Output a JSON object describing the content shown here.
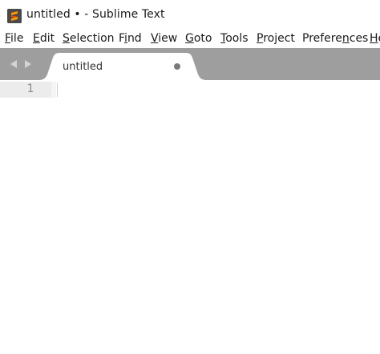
{
  "window": {
    "title": "untitled • - Sublime Text",
    "app_icon": "sublime-text-logo-icon"
  },
  "menu": {
    "items": [
      {
        "label": "File",
        "mnemonic": "F"
      },
      {
        "label": "Edit",
        "mnemonic": "E"
      },
      {
        "label": "Selection",
        "mnemonic": "S"
      },
      {
        "label": "Find",
        "mnemonic": "i"
      },
      {
        "label": "View",
        "mnemonic": "V"
      },
      {
        "label": "Goto",
        "mnemonic": "G"
      },
      {
        "label": "Tools",
        "mnemonic": "T"
      },
      {
        "label": "Project",
        "mnemonic": "P"
      },
      {
        "label": "Preferences",
        "mnemonic": "n"
      },
      {
        "label": "He",
        "mnemonic": "H"
      }
    ]
  },
  "tabs": [
    {
      "label": "untitled",
      "dirty": true,
      "active": true
    }
  ],
  "editor": {
    "line_numbers": [
      "1"
    ],
    "content": ""
  },
  "colors": {
    "tabbar_bg": "#9e9e9e",
    "tab_active_bg": "#ffffff",
    "gutter_highlight": "#ececec",
    "app_icon_bg": "#4a4a4a",
    "app_icon_accent": "#ff9800"
  }
}
